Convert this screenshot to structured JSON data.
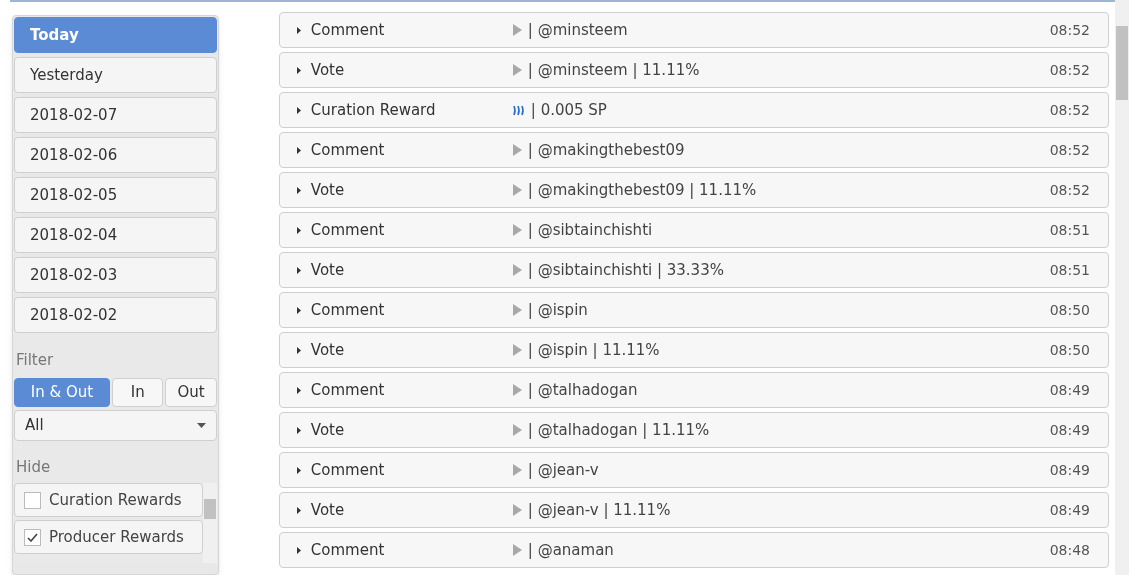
{
  "days": [
    {
      "label": "Today",
      "selected": true
    },
    {
      "label": "Yesterday",
      "selected": false
    },
    {
      "label": "2018-02-07",
      "selected": false
    },
    {
      "label": "2018-02-06",
      "selected": false
    },
    {
      "label": "2018-02-05",
      "selected": false
    },
    {
      "label": "2018-02-04",
      "selected": false
    },
    {
      "label": "2018-02-03",
      "selected": false
    },
    {
      "label": "2018-02-02",
      "selected": false
    }
  ],
  "filter": {
    "label": "Filter",
    "directions": [
      {
        "label": "In & Out",
        "selected": true
      },
      {
        "label": "In",
        "selected": false
      },
      {
        "label": "Out",
        "selected": false
      }
    ],
    "type_select": {
      "value": "All"
    }
  },
  "hide": {
    "label": "Hide",
    "items": [
      {
        "label": "Curation Rewards",
        "checked": false
      },
      {
        "label": "Producer Rewards",
        "checked": true
      }
    ]
  },
  "operations": [
    {
      "kind": "post",
      "type": "Comment",
      "detail": "| @minsteem",
      "time": "08:52"
    },
    {
      "kind": "post",
      "type": "Vote",
      "detail": "| @minsteem | 11.11%",
      "time": "08:52"
    },
    {
      "kind": "reward",
      "type": "Curation Reward",
      "detail": "| 0.005 SP",
      "time": "08:52"
    },
    {
      "kind": "post",
      "type": "Comment",
      "detail": "| @makingthebest09",
      "time": "08:52"
    },
    {
      "kind": "post",
      "type": "Vote",
      "detail": "| @makingthebest09 | 11.11%",
      "time": "08:52"
    },
    {
      "kind": "post",
      "type": "Comment",
      "detail": "| @sibtainchishti",
      "time": "08:51"
    },
    {
      "kind": "post",
      "type": "Vote",
      "detail": "| @sibtainchishti | 33.33%",
      "time": "08:51"
    },
    {
      "kind": "post",
      "type": "Comment",
      "detail": "| @ispin",
      "time": "08:50"
    },
    {
      "kind": "post",
      "type": "Vote",
      "detail": "| @ispin | 11.11%",
      "time": "08:50"
    },
    {
      "kind": "post",
      "type": "Comment",
      "detail": "| @talhadogan",
      "time": "08:49"
    },
    {
      "kind": "post",
      "type": "Vote",
      "detail": "| @talhadogan | 11.11%",
      "time": "08:49"
    },
    {
      "kind": "post",
      "type": "Comment",
      "detail": "| @jean-v",
      "time": "08:49"
    },
    {
      "kind": "post",
      "type": "Vote",
      "detail": "| @jean-v | 11.11%",
      "time": "08:49"
    },
    {
      "kind": "post",
      "type": "Comment",
      "detail": "| @anaman",
      "time": "08:48"
    }
  ]
}
